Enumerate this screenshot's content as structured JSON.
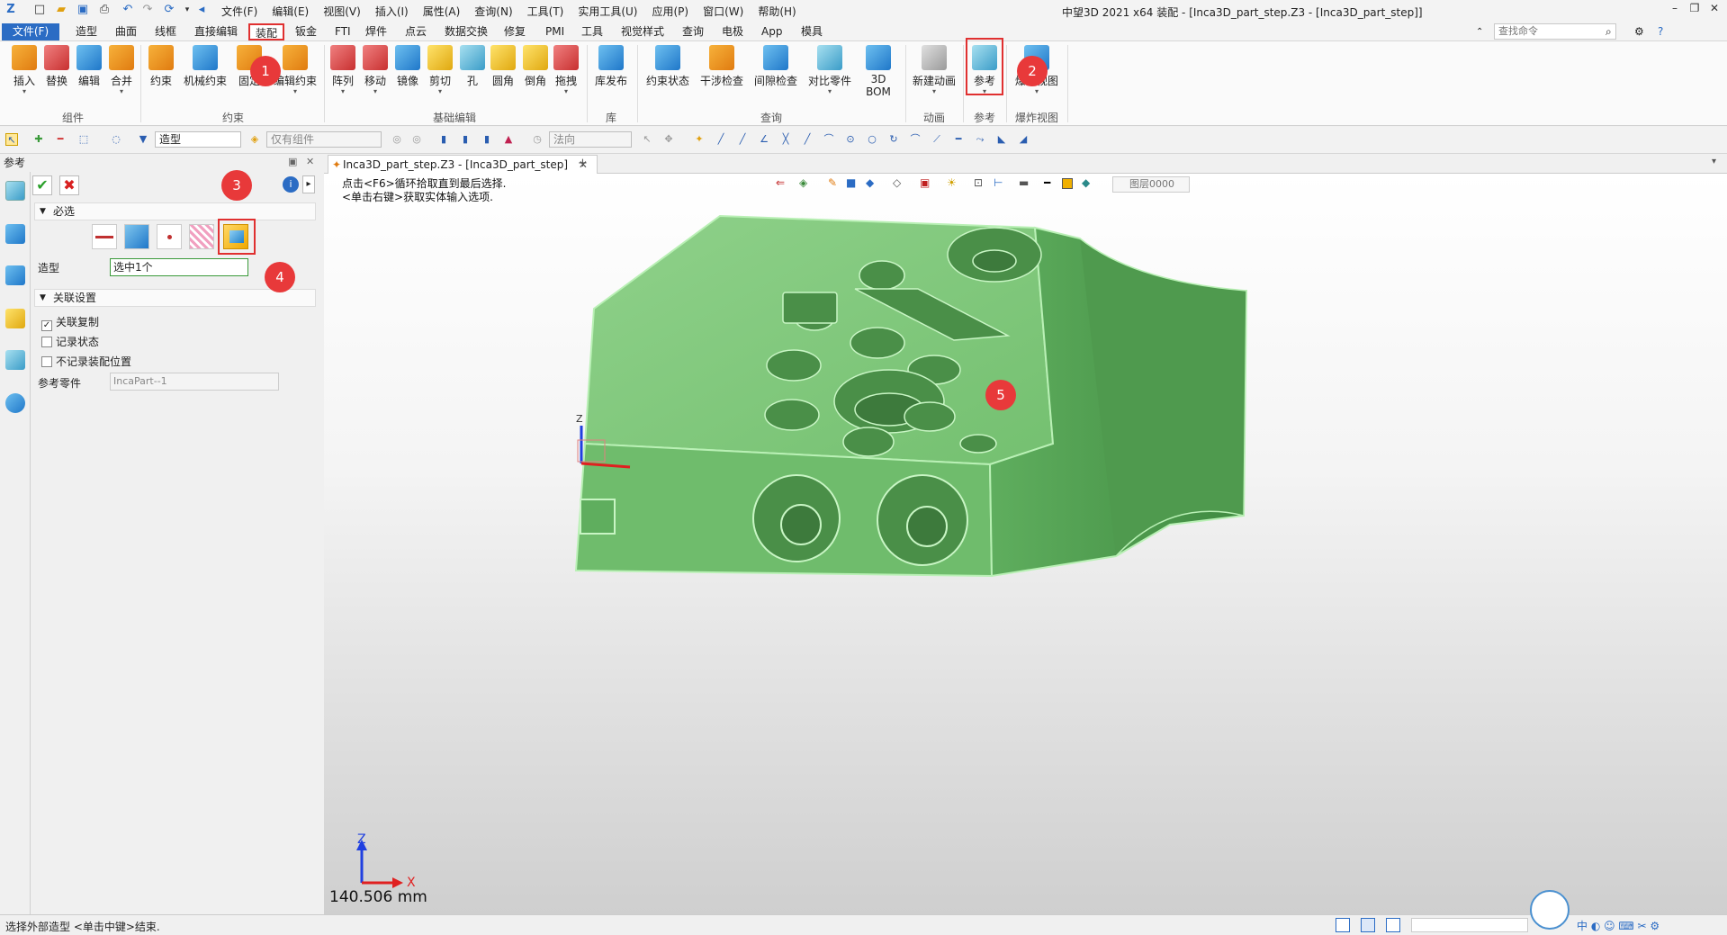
{
  "titlebar": {
    "menus": [
      "文件(F)",
      "编辑(E)",
      "视图(V)",
      "插入(I)",
      "属性(A)",
      "查询(N)",
      "工具(T)",
      "实用工具(U)",
      "应用(P)",
      "窗口(W)",
      "帮助(H)"
    ],
    "app_title": "中望3D 2021 x64     装配 - [Inca3D_part_step.Z3 - [Inca3D_part_step]]"
  },
  "ribbon_tabs": [
    "文件(F)",
    "造型",
    "曲面",
    "线框",
    "直接编辑",
    "装配",
    "钣金",
    "FTI",
    "焊件",
    "点云",
    "数据交换",
    "修复",
    "PMI",
    "工具",
    "视觉样式",
    "查询",
    "电极",
    "App",
    "模具"
  ],
  "search_placeholder": "查找命令",
  "ribbon": {
    "groups": [
      {
        "label": "组件",
        "buttons": [
          "插入",
          "替换",
          "编辑",
          "合并"
        ]
      },
      {
        "label": "约束",
        "buttons": [
          "约束",
          "机械约束",
          "固定",
          "编辑约束"
        ]
      },
      {
        "label": "基础编辑",
        "buttons": [
          "阵列",
          "移动",
          "镜像",
          "剪切",
          "孔",
          "圆角",
          "倒角",
          "拖拽"
        ]
      },
      {
        "label": "库",
        "buttons": [
          "库发布"
        ]
      },
      {
        "label": "查询",
        "buttons": [
          "约束状态",
          "干涉检查",
          "间隙检查",
          "对比零件",
          "3D BOM"
        ]
      },
      {
        "label": "动画",
        "buttons": [
          "新建动画"
        ]
      },
      {
        "label": "参考",
        "buttons": [
          "参考"
        ]
      },
      {
        "label": "爆炸视图",
        "buttons": [
          "爆炸视图"
        ]
      }
    ]
  },
  "toolbar2": {
    "filter_value": "造型",
    "scope_value": "仅有组件",
    "direction_value": "法向"
  },
  "panel": {
    "title": "参考",
    "section_required": "必选",
    "field_label": "造型",
    "field_value": "选中1个",
    "section_assoc": "关联设置",
    "checkboxes": [
      {
        "label": "关联复制",
        "checked": true
      },
      {
        "label": "记录状态",
        "checked": false
      },
      {
        "label": "不记录装配位置",
        "checked": false
      }
    ],
    "ref_part_label": "参考零件",
    "ref_part_value": "IncaPart--1"
  },
  "doc_tab": "Inca3D_part_step.Z3 - [Inca3D_part_step]",
  "viewport": {
    "hint_line1": "点击<F6>循环拾取直到最后选择.",
    "hint_line2": "<单击右键>获取实体输入选项.",
    "layer": "图层0000",
    "scale": "140.506 mm",
    "axis_x": "X",
    "axis_z": "Z"
  },
  "status": "选择外部造型 <单击中键>结束.",
  "markers": [
    "1",
    "2",
    "3",
    "4",
    "5"
  ],
  "colors": {
    "accent": "#2b6cc4",
    "highlight": "#e03030",
    "part": "#7cc47a",
    "marker": "#e8393a"
  }
}
